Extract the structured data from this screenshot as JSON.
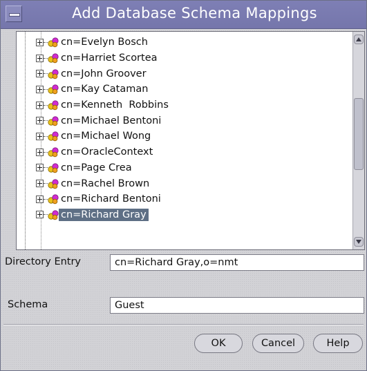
{
  "window": {
    "title": "Add Database Schema Mappings"
  },
  "tree": {
    "items": [
      {
        "label": "cn=Evelyn Bosch",
        "selected": false
      },
      {
        "label": "cn=Harriet Scortea",
        "selected": false
      },
      {
        "label": "cn=John Groover",
        "selected": false
      },
      {
        "label": "cn=Kay Cataman",
        "selected": false
      },
      {
        "label": "cn=Kenneth  Robbins",
        "selected": false
      },
      {
        "label": "cn=Michael Bentoni",
        "selected": false
      },
      {
        "label": "cn=Michael Wong",
        "selected": false
      },
      {
        "label": "cn=OracleContext",
        "selected": false
      },
      {
        "label": "cn=Page Crea",
        "selected": false
      },
      {
        "label": "cn=Rachel Brown",
        "selected": false
      },
      {
        "label": "cn=Richard Bentoni",
        "selected": false
      },
      {
        "label": "cn=Richard Gray",
        "selected": true
      }
    ],
    "node_icon": "directory-entry-icon",
    "expander_icon": "expand-plus-icon"
  },
  "form": {
    "directory_entry_label": "Directory Entry",
    "directory_entry_value": "cn=Richard Gray,o=nmt",
    "schema_label": "Schema",
    "schema_value": "Guest"
  },
  "buttons": {
    "ok": "OK",
    "cancel": "Cancel",
    "help": "Help"
  },
  "colors": {
    "titlebar": "#7877ad",
    "selection": "#5e6f85"
  }
}
